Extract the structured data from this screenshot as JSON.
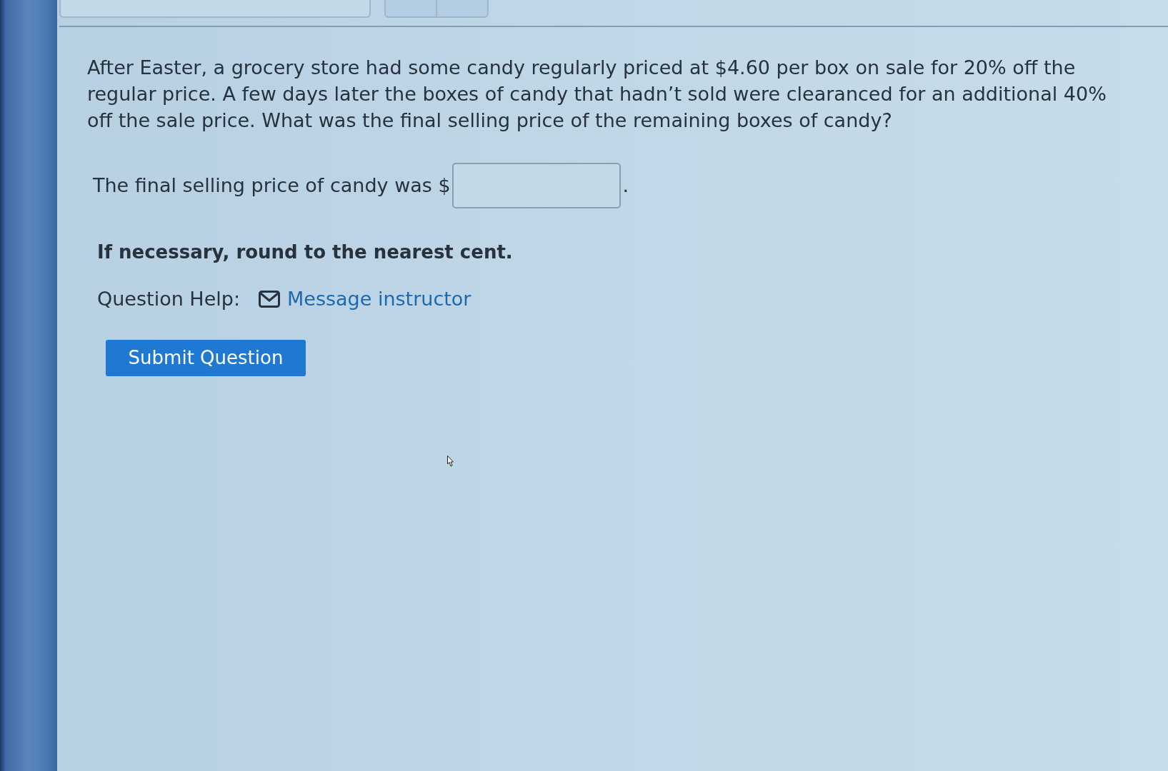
{
  "question": {
    "text": "After Easter, a grocery store had some candy regularly priced at $4.60 per box on sale for 20% off the regular price. A few days later the boxes of candy that hadn’t sold were clearanced for an additional 40% off the sale price. What was the final selling price of the remaining boxes of candy?"
  },
  "answer": {
    "prompt": "The final selling price of candy was $",
    "suffix": "."
  },
  "note": "If necessary, round to the nearest cent.",
  "help": {
    "label": "Question Help:",
    "link": "Message instructor"
  },
  "submit_button": "Submit Question"
}
